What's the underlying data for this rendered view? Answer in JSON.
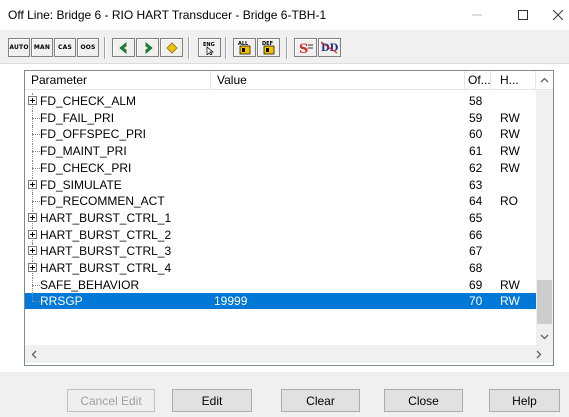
{
  "window": {
    "title": "Off Line: Bridge 6 -  RIO HART Transducer - Bridge 6-TBH-1"
  },
  "toolbar": {
    "mode_buttons": [
      "AUTO",
      "MAN",
      "CAS",
      "OOS"
    ],
    "icons": [
      "previous-arrow-icon",
      "next-arrow-icon",
      "diamond-icon",
      "engineering-icon",
      "all-parameters-icon",
      "default-parameters-icon",
      "signal-icon",
      "detail-display-icon"
    ]
  },
  "table": {
    "columns": [
      "Parameter",
      "Value",
      "Of...",
      "H..."
    ],
    "rows": [
      {
        "param": "FD_CHECK_ALM",
        "value": "",
        "offset": "58",
        "access": "",
        "expandable": true,
        "selected": false
      },
      {
        "param": "FD_FAIL_PRI",
        "value": "",
        "offset": "59",
        "access": "RW",
        "expandable": false,
        "selected": false
      },
      {
        "param": "FD_OFFSPEC_PRI",
        "value": "",
        "offset": "60",
        "access": "RW",
        "expandable": false,
        "selected": false
      },
      {
        "param": "FD_MAINT_PRI",
        "value": "",
        "offset": "61",
        "access": "RW",
        "expandable": false,
        "selected": false
      },
      {
        "param": "FD_CHECK_PRI",
        "value": "",
        "offset": "62",
        "access": "RW",
        "expandable": false,
        "selected": false
      },
      {
        "param": "FD_SIMULATE",
        "value": "",
        "offset": "63",
        "access": "",
        "expandable": true,
        "selected": false
      },
      {
        "param": "FD_RECOMMEN_ACT",
        "value": "",
        "offset": "64",
        "access": "RO",
        "expandable": false,
        "selected": false
      },
      {
        "param": "HART_BURST_CTRL_1",
        "value": "",
        "offset": "65",
        "access": "",
        "expandable": true,
        "selected": false
      },
      {
        "param": "HART_BURST_CTRL_2",
        "value": "",
        "offset": "66",
        "access": "",
        "expandable": true,
        "selected": false
      },
      {
        "param": "HART_BURST_CTRL_3",
        "value": "",
        "offset": "67",
        "access": "",
        "expandable": true,
        "selected": false
      },
      {
        "param": "HART_BURST_CTRL_4",
        "value": "",
        "offset": "68",
        "access": "",
        "expandable": true,
        "selected": false
      },
      {
        "param": "SAFE_BEHAVIOR",
        "value": "",
        "offset": "69",
        "access": "RW",
        "expandable": false,
        "selected": false
      },
      {
        "param": "RRSGP",
        "value": "19999",
        "offset": "70",
        "access": "RW",
        "expandable": false,
        "selected": true
      }
    ]
  },
  "footer": {
    "cancel_edit": "Cancel Edit",
    "edit": "Edit",
    "clear": "Clear",
    "close": "Close",
    "help": "Help"
  },
  "colors": {
    "selection": "#0078d7",
    "prev_arrow": "#1a9b2c",
    "next_arrow": "#1a9b2c",
    "diamond": "#f2c200",
    "signal": "#d62b2b"
  }
}
